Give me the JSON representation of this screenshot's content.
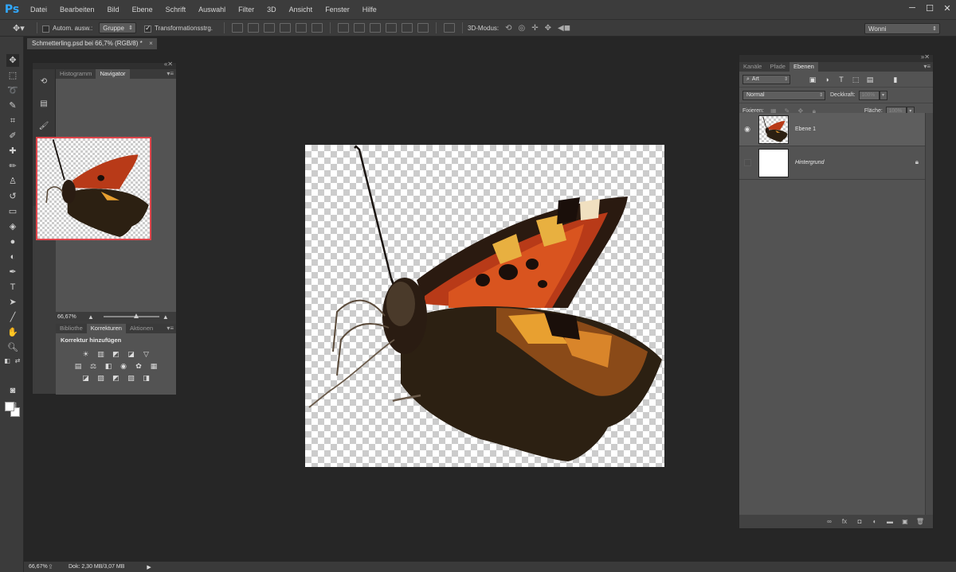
{
  "app": {
    "logo": "Ps"
  },
  "menu": [
    "Datei",
    "Bearbeiten",
    "Bild",
    "Ebene",
    "Schrift",
    "Auswahl",
    "Filter",
    "3D",
    "Ansicht",
    "Fenster",
    "Hilfe"
  ],
  "options": {
    "auto_select_label": "Autom. ausw.:",
    "auto_select_checked": false,
    "auto_select_value": "Gruppe",
    "transform_label": "Transformationsstrg.",
    "transform_checked": true,
    "mode3d_label": "3D-Modus:",
    "workspace": "Wonni"
  },
  "document": {
    "tab_title": "Schmetterling.psd bei 66,7% (RGB/8) *",
    "close": "×"
  },
  "navigator_dock": {
    "tabs": [
      "Histogramm",
      "Navigator"
    ],
    "active_tab": "Navigator",
    "zoom": "66,67%"
  },
  "adjustments_dock": {
    "tabs": [
      "Bibliothe",
      "Korrekturen",
      "Aktionen"
    ],
    "active_tab": "Korrekturen",
    "title": "Korrektur hinzufügen"
  },
  "layers_dock": {
    "tabs": [
      "Kanäle",
      "Pfade",
      "Ebenen"
    ],
    "active_tab": "Ebenen",
    "filter_type": "Art",
    "blend_mode": "Normal",
    "opacity_label": "Deckkraft:",
    "opacity_value": "100%",
    "lock_label": "Fixieren:",
    "fill_label": "Fläche:",
    "fill_value": "100%",
    "layers": [
      {
        "name": "Ebene 1",
        "visible": true,
        "selected": true
      },
      {
        "name": "Hintergrund",
        "visible": false,
        "selected": false,
        "locked": true
      }
    ]
  },
  "status": {
    "zoom": "66,67%",
    "doc": "Dok: 2,30 MB/3,07 MB"
  },
  "colors": {
    "accent_nav_border": "#e0464c",
    "ps_logo": "#31a8ff",
    "foreground": "#ffffff",
    "background": "#ffffff"
  }
}
